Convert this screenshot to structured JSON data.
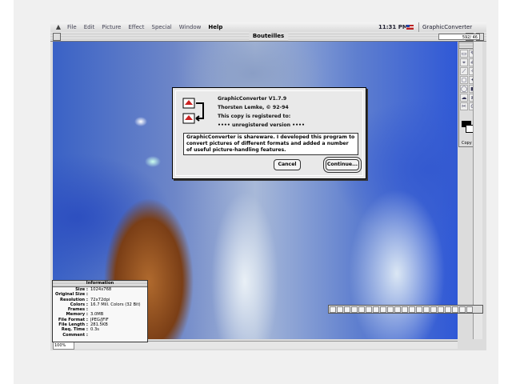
{
  "menubar": {
    "apple": "",
    "items": [
      "File",
      "Edit",
      "Picture",
      "Effect",
      "Special",
      "Window",
      "Help"
    ],
    "clock": "11:31 PM",
    "app_label": "GraphicConverter"
  },
  "window": {
    "title": "Bouteilles",
    "coords": "592/ 46",
    "zoom": "100%"
  },
  "palette": {
    "tools": [
      "▭",
      "✎",
      "⌖",
      "✐",
      "⟋",
      "✧",
      "▢",
      "✦",
      "◯",
      "◼",
      "☁",
      "⧈",
      "✂",
      "⊙"
    ],
    "swatch_label": "Copy",
    "colors": {
      "fg": "#000000",
      "bg": "#ffffff"
    }
  },
  "dialog": {
    "line1": "GraphicConverter V1.7.9",
    "line2": "Thorsten Lemke, © 92-94",
    "line3": "This copy is registered to:",
    "line4": "•••• unregistered version ••••",
    "message": "GraphicConverter is shareware. I developed this program to convert pictures of different formats and added a number of useful picture-handling features.",
    "cancel": "Cancel",
    "continue": "Continue..."
  },
  "info": {
    "title": "Information",
    "rows": [
      {
        "k": "Size :",
        "v": "1024x768"
      },
      {
        "k": "Original Size :",
        "v": ""
      },
      {
        "k": "Resolution :",
        "v": "72x72dpi"
      },
      {
        "k": "Colors :",
        "v": "16.7 Mill. Colors (32 Bit)"
      },
      {
        "k": "Frames :",
        "v": ""
      },
      {
        "k": "Memory :",
        "v": "3.0MB"
      },
      {
        "k": "File Format :",
        "v": "JPEG/JFIF"
      },
      {
        "k": "File Length :",
        "v": "281.5KB"
      },
      {
        "k": "Req. Time :",
        "v": "0.3s"
      },
      {
        "k": "Comment :",
        "v": ""
      }
    ]
  }
}
